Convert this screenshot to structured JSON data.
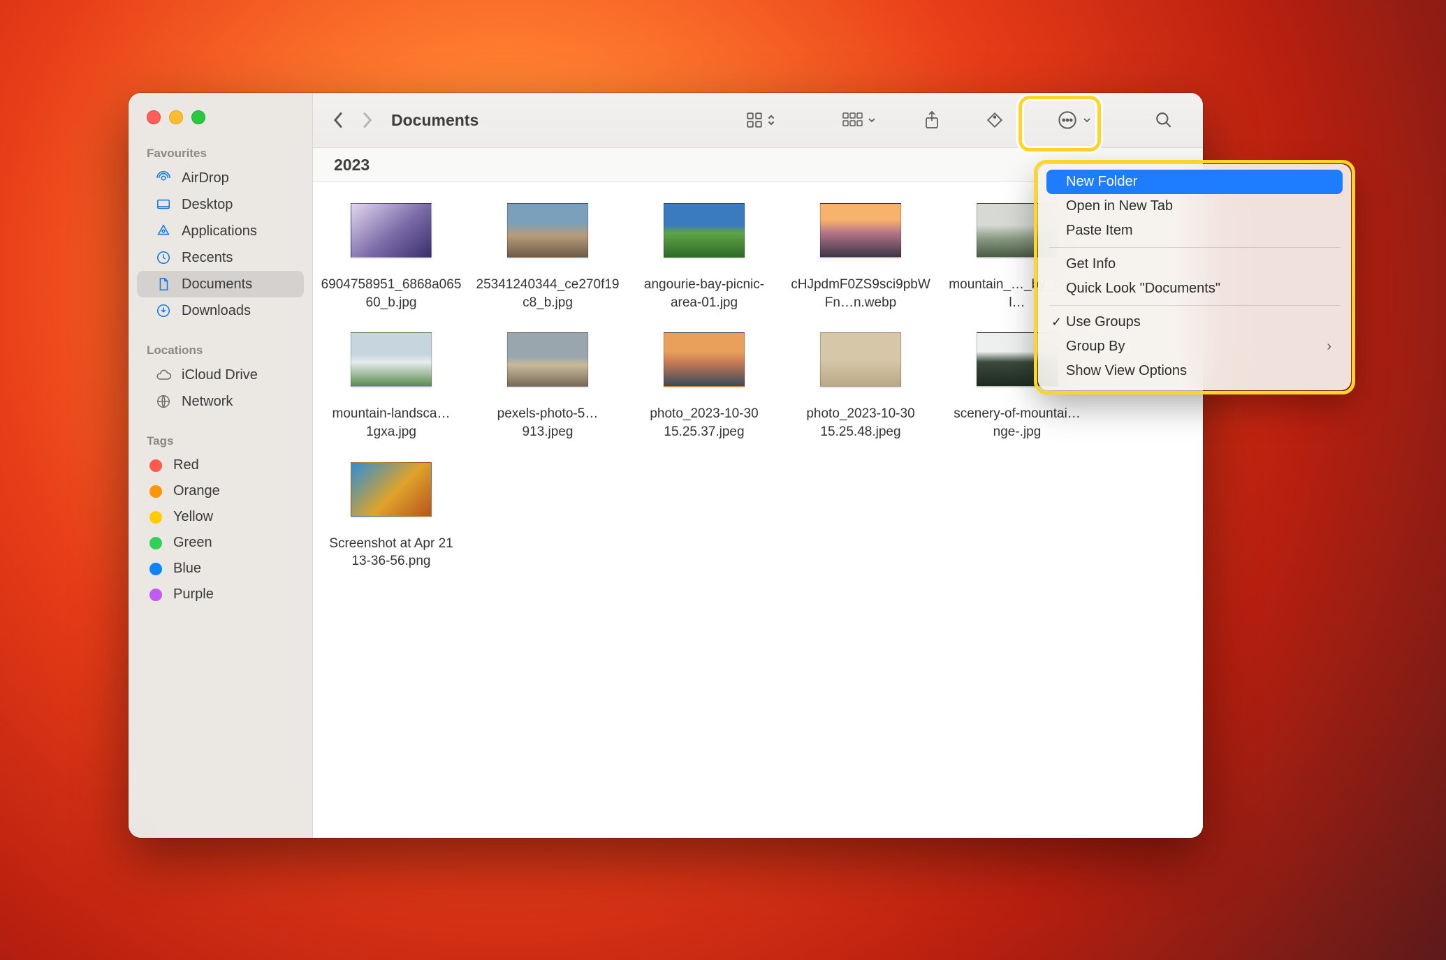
{
  "window_title": "Documents",
  "group_header": "2023",
  "sidebar": {
    "favourites_header": "Favourites",
    "favourites": [
      {
        "label": "AirDrop",
        "icon": "airdrop"
      },
      {
        "label": "Desktop",
        "icon": "desktop"
      },
      {
        "label": "Applications",
        "icon": "apps"
      },
      {
        "label": "Recents",
        "icon": "recents"
      },
      {
        "label": "Documents",
        "icon": "doc",
        "active": true
      },
      {
        "label": "Downloads",
        "icon": "downloads"
      }
    ],
    "locations_header": "Locations",
    "locations": [
      {
        "label": "iCloud Drive",
        "icon": "cloud"
      },
      {
        "label": "Network",
        "icon": "network"
      }
    ],
    "tags_header": "Tags",
    "tags": [
      {
        "label": "Red",
        "color": "#ff5a4d"
      },
      {
        "label": "Orange",
        "color": "#ff9500"
      },
      {
        "label": "Yellow",
        "color": "#ffcc00"
      },
      {
        "label": "Green",
        "color": "#30d158"
      },
      {
        "label": "Blue",
        "color": "#0a84ff"
      },
      {
        "label": "Purple",
        "color": "#bf5af2"
      }
    ]
  },
  "files": [
    {
      "name": "6904758951_6868a06560_b.jpg",
      "bg": "linear-gradient(140deg,#e2d7ee,#7a6ba8 55%,#3a2f6b)"
    },
    {
      "name": "25341240344_ce270f19c8_b.jpg",
      "bg": "linear-gradient(180deg,#7aa0bb 35%,#b89b7a 60%,#6d5b48)"
    },
    {
      "name": "angourie-bay-picnic-area-01.jpg",
      "bg": "linear-gradient(180deg,#3a7abf 40%,#5fa547 55%,#2e6a2a)"
    },
    {
      "name": "cHJpdmF0ZS9sci9pbWFn…n.webp",
      "bg": "linear-gradient(180deg,#f7b26b 30%,#b37488 55%,#3c3548)"
    },
    {
      "name": "mountain_…_by_bur…l…",
      "bg": "linear-gradient(180deg,#d7d9d5 40%,#8a9b84 65%,#4a5a44)"
    },
    {
      "name": "mountain-landsca…1gxa.jpg",
      "bg": "linear-gradient(180deg,#c7d5de 40%,#e6edef 55%,#5a8a4c)"
    },
    {
      "name": "pexels-photo-5…913.jpeg",
      "bg": "linear-gradient(180deg,#9aa6ad 45%,#c9b99b 60%,#776a58)"
    },
    {
      "name": "photo_2023-10-30 15.25.37.jpeg",
      "bg": "linear-gradient(180deg,#e8a05a 35%,#c77a54 55%,#3a4a5a)"
    },
    {
      "name": "photo_2023-10-30 15.25.48.jpeg",
      "bg": "linear-gradient(180deg,#d6c7a8 50%,#b9a988)"
    },
    {
      "name": "scenery-of-mountai…nge-.jpg",
      "bg": "linear-gradient(180deg,#eef0ef 35%,#3a4a3c 55%,#1e2a20)"
    },
    {
      "name": "Screenshot at Apr 21 13-36-56.png",
      "bg": "linear-gradient(135deg,#2a8ed8,#e0a32a 55%,#b7541e)"
    }
  ],
  "menu": {
    "items": [
      {
        "label": "New Folder",
        "selected": true
      },
      {
        "label": "Open in New Tab"
      },
      {
        "label": "Paste Item"
      },
      {
        "divider": true
      },
      {
        "label": "Get Info"
      },
      {
        "label": "Quick Look \"Documents\""
      },
      {
        "divider": true
      },
      {
        "label": "Use Groups",
        "checked": true
      },
      {
        "label": "Group By",
        "submenu": true
      },
      {
        "label": "Show View Options"
      }
    ]
  }
}
